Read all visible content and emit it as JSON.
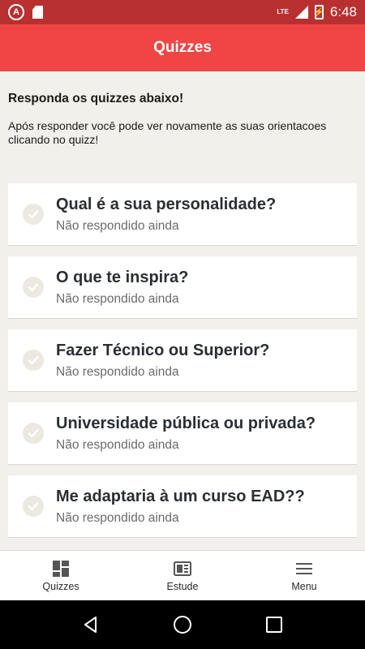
{
  "status_bar": {
    "app_badge": "A",
    "network": "LTE",
    "battery_label": "⚡",
    "time": "6:48"
  },
  "app_bar": {
    "title": "Quizzes"
  },
  "intro": {
    "heading": "Responda os quizzes abaixo!",
    "text": "Após responder você pode ver novamente as suas orientacoes clicando no quizz!"
  },
  "quizzes": [
    {
      "title": "Qual é a sua personalidade?",
      "status": "Não respondido ainda"
    },
    {
      "title": "O que te inspira?",
      "status": "Não respondido ainda"
    },
    {
      "title": "Fazer Técnico ou Superior?",
      "status": "Não respondido ainda"
    },
    {
      "title": "Universidade pública ou privada?",
      "status": "Não respondido ainda"
    },
    {
      "title": "Me adaptaria à um curso EAD??",
      "status": "Não respondido ainda"
    }
  ],
  "bottom_nav": [
    {
      "label": "Quizzes",
      "icon": "dashboard-icon"
    },
    {
      "label": "Estude",
      "icon": "book-icon"
    },
    {
      "label": "Menu",
      "icon": "menu-icon"
    }
  ],
  "colors": {
    "status_bar": "#b8302f",
    "app_bar": "#ef4545",
    "background": "#f2f0eb"
  }
}
